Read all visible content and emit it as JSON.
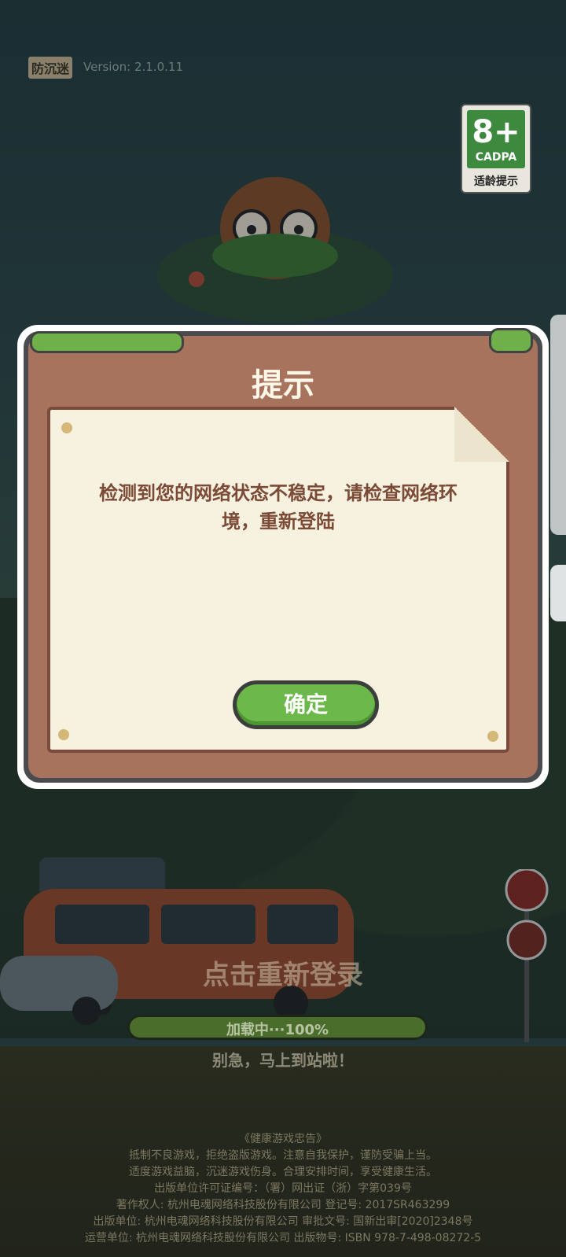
{
  "header": {
    "anti_addiction_label": "防沉迷",
    "version_text": "Version: 2.1.0.11"
  },
  "age_rating": {
    "age": "8+",
    "org": "CADPA",
    "tip": "适龄提示"
  },
  "loading": {
    "tap_relogin": "点击重新登录",
    "progress_text": "加载中···100%",
    "progress_fraction": 1.0,
    "hint": "别急，马上到站啦！"
  },
  "footer": {
    "lines": [
      "《健康游戏忠告》",
      "抵制不良游戏，拒绝盗版游戏。注意自我保护，谨防受骗上当。",
      "适度游戏益脑，沉迷游戏伤身。合理安排时间，享受健康生活。",
      "出版单位许可证编号：（署）网出证（浙）字第039号",
      "著作权人: 杭州电魂网络科技股份有限公司 登记号: 2017SR463299",
      "出版单位: 杭州电魂网络科技股份有限公司 审批文号: 国新出审[2020]2348号",
      "运营单位: 杭州电魂网络科技股份有限公司 出版物号: ISBN 978-7-498-08272-5"
    ]
  },
  "dialog": {
    "title": "提示",
    "message": "检测到您的网络状态不稳定，请检查网络环境，重新登陆",
    "ok_label": "确定"
  },
  "colors": {
    "accent_green": "#6cb84a",
    "wood": "#a8735c",
    "paper": "#f7f1df",
    "text_brown": "#7b4b37"
  }
}
